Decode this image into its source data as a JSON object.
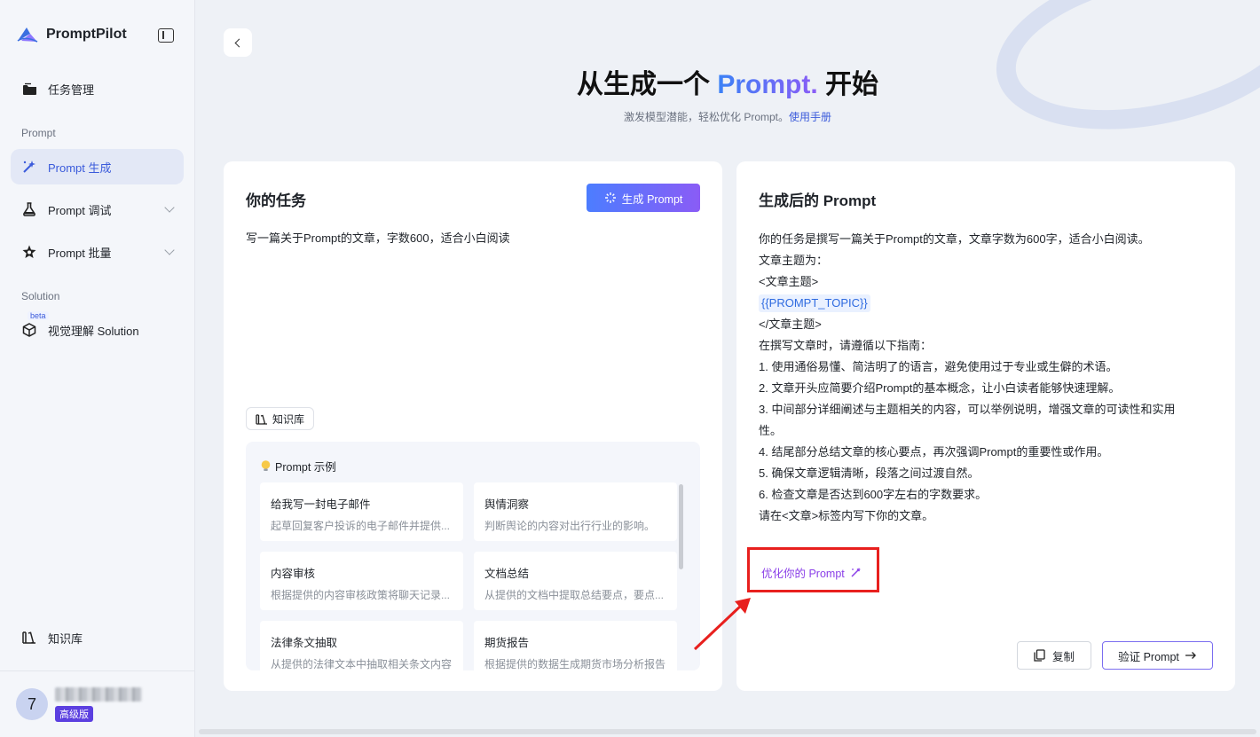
{
  "brand": {
    "name": "PromptPilot"
  },
  "sidebar": {
    "items": [
      {
        "label": "任务管理"
      },
      {
        "label": "Prompt 生成"
      },
      {
        "label": "Prompt 调试"
      },
      {
        "label": "Prompt 批量"
      },
      {
        "label": "视觉理解 Solution"
      },
      {
        "label": "知识库"
      }
    ],
    "section_prompt": "Prompt",
    "section_solution": "Solution",
    "beta": "beta"
  },
  "user": {
    "avatar": "7",
    "name": "(redacted)",
    "plan": "高级版"
  },
  "hero": {
    "title_pre": "从生成一个 ",
    "title_accent": "Prompt.",
    "title_post": " 开始",
    "subtitle": "激发模型潜能，轻松优化 Prompt。",
    "manual_link": "使用手册"
  },
  "task_card": {
    "title": "你的任务",
    "generate_button": "生成 Prompt",
    "task_text": "写一篇关于Prompt的文章，字数600，适合小白阅读",
    "knowledge_chip": "知识库",
    "examples_title": "Prompt 示例",
    "examples": [
      {
        "title": "给我写一封电子邮件",
        "desc": "起草回复客户投诉的电子邮件并提供..."
      },
      {
        "title": "舆情洞察",
        "desc": "判断舆论的内容对出行行业的影响。"
      },
      {
        "title": "内容审核",
        "desc": "根据提供的内容审核政策将聊天记录..."
      },
      {
        "title": "文档总结",
        "desc": "从提供的文档中提取总结要点，要点..."
      },
      {
        "title": "法律条文抽取",
        "desc": "从提供的法律文本中抽取相关条文内容"
      },
      {
        "title": "期货报告",
        "desc": "根据提供的数据生成期货市场分析报告"
      }
    ]
  },
  "result_card": {
    "title": "生成后的 Prompt",
    "lines": [
      "你的任务是撰写一篇关于Prompt的文章，文章字数为600字，适合小白阅读。",
      "文章主题为：",
      "<文章主题>",
      "{{PROMPT_TOPIC}}",
      "</文章主题>",
      "在撰写文章时，请遵循以下指南：",
      "1. 使用通俗易懂、简洁明了的语言，避免使用过于专业或生僻的术语。",
      "2. 文章开头应简要介绍Prompt的基本概念，让小白读者能够快速理解。",
      "3. 中间部分详细阐述与主题相关的内容，可以举例说明，增强文章的可读性和实用",
      "性。",
      "4. 结尾部分总结文章的核心要点，再次强调Prompt的重要性或作用。",
      "5. 确保文章逻辑清晰，段落之间过渡自然。",
      "6. 检查文章是否达到600字左右的字数要求。",
      "请在<文章>标签内写下你的文章。"
    ],
    "optimize_link": "优化你的 Prompt",
    "copy_button": "复制",
    "verify_button": "验证 Prompt"
  },
  "colors": {
    "accent": "#3b5bdb",
    "highlight": "#e8201e",
    "optimize": "#8b40e8"
  }
}
